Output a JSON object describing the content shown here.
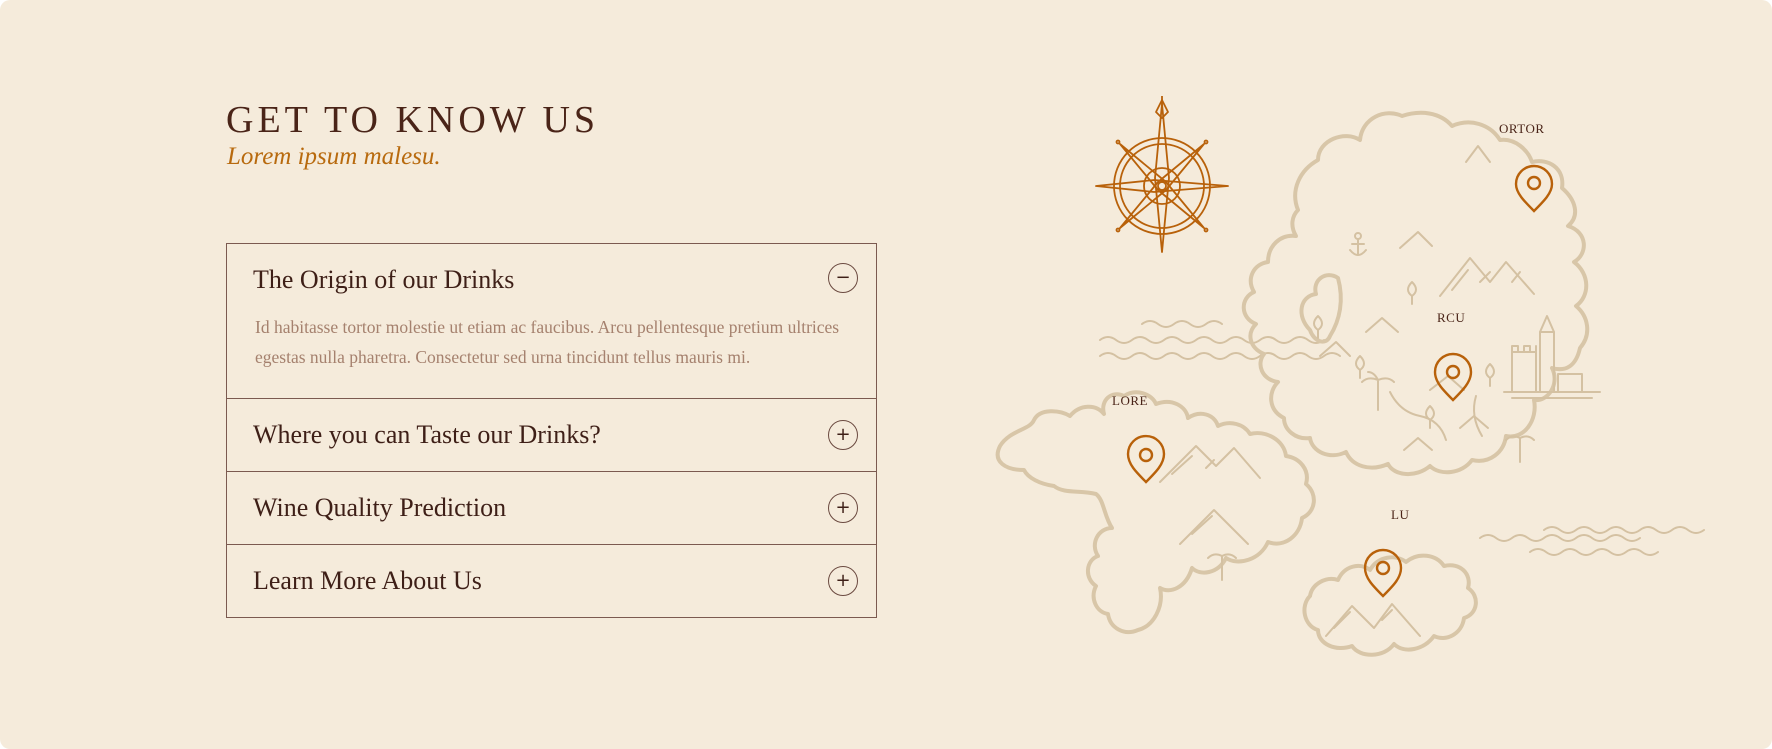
{
  "section": {
    "title": "GET TO KNOW US",
    "subtitle": "Lorem ipsum malesu."
  },
  "accordion": [
    {
      "title": "The Origin of our Drinks",
      "expanded": true,
      "toggle_symbol": "−",
      "body": "Id habitasse tortor molestie ut etiam ac faucibus. Arcu pellentesque pretium ultrices egestas nulla pharetra. Consectetur sed urna tincidunt tellus mauris mi."
    },
    {
      "title": "Where you can Taste our Drinks?",
      "expanded": false,
      "toggle_symbol": "+"
    },
    {
      "title": "Wine Quality Prediction",
      "expanded": false,
      "toggle_symbol": "+"
    },
    {
      "title": "Learn More About Us",
      "expanded": false,
      "toggle_symbol": "+"
    }
  ],
  "map": {
    "labels": {
      "ortor": "ORTOR",
      "rcu": "RCU",
      "lore": "LORE",
      "lu": "LU"
    },
    "icons": [
      "compass-rose-icon",
      "anchor-icon",
      "map-pin-icon",
      "castle-icon",
      "palm-tree-icon",
      "mountain-icon",
      "tree-icon",
      "waves-icon"
    ]
  },
  "colors": {
    "background": "#f5ebdb",
    "heading": "#4a2418",
    "accent": "#b86a0e",
    "body_text": "#a5816e",
    "border": "#7b5a50",
    "map_line": "#d8c6a8",
    "pin": "#b8610a"
  }
}
